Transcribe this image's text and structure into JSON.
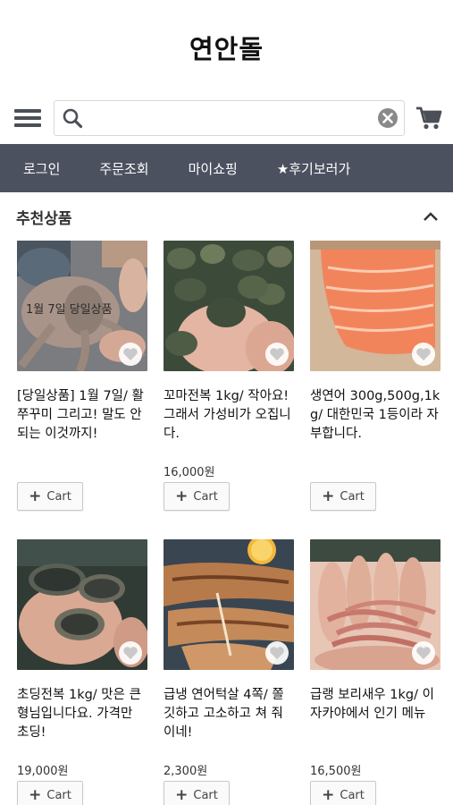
{
  "header": {
    "logo": "연안돌"
  },
  "search": {
    "placeholder": "",
    "value": ""
  },
  "icons": {
    "menu": "hamburger-icon",
    "search": "search-icon",
    "clear": "clear-icon",
    "cart": "cart-icon"
  },
  "nav": {
    "items": [
      {
        "label": "로그인"
      },
      {
        "label": "주문조회"
      },
      {
        "label": "마이쇼핑"
      },
      {
        "label": "★후기보러가"
      }
    ]
  },
  "section": {
    "title": "추천상품"
  },
  "products": [
    {
      "name": "[당일상품] 1월 7일/ 활쭈꾸미 그리고! 말도 안되는 이것까지!",
      "price": "",
      "overlay": "1월 7일 당일상품",
      "cart_label": "Cart"
    },
    {
      "name": "꼬마전복 1kg/ 작아요! 그래서 가성비가 오집니다.",
      "price": "16,000원",
      "overlay": "",
      "cart_label": "Cart"
    },
    {
      "name": "생연어 300g,500g,1kg/ 대한민국 1등이라 자부합니다.",
      "price": "",
      "overlay": "",
      "cart_label": "Cart"
    },
    {
      "name": "초딩전복 1kg/ 맛은 큰형님입니다요. 가격만 초딩!",
      "price": "19,000원",
      "overlay": "",
      "cart_label": "Cart"
    },
    {
      "name": "급냉 연어턱살 4쪽/ 쫄깃하고 고소하고 쳐 줘이네!",
      "price": "2,300원",
      "overlay": "",
      "cart_label": "Cart"
    },
    {
      "name": "급랭 보리새우 1kg/ 이자카야에서 인기 메뉴",
      "price": "16,500원",
      "overlay": "",
      "cart_label": "Cart"
    }
  ],
  "colors": {
    "nav_bg": "#4c5160",
    "icon": "#4b4f57",
    "accent_salmon": "#f2845c"
  }
}
